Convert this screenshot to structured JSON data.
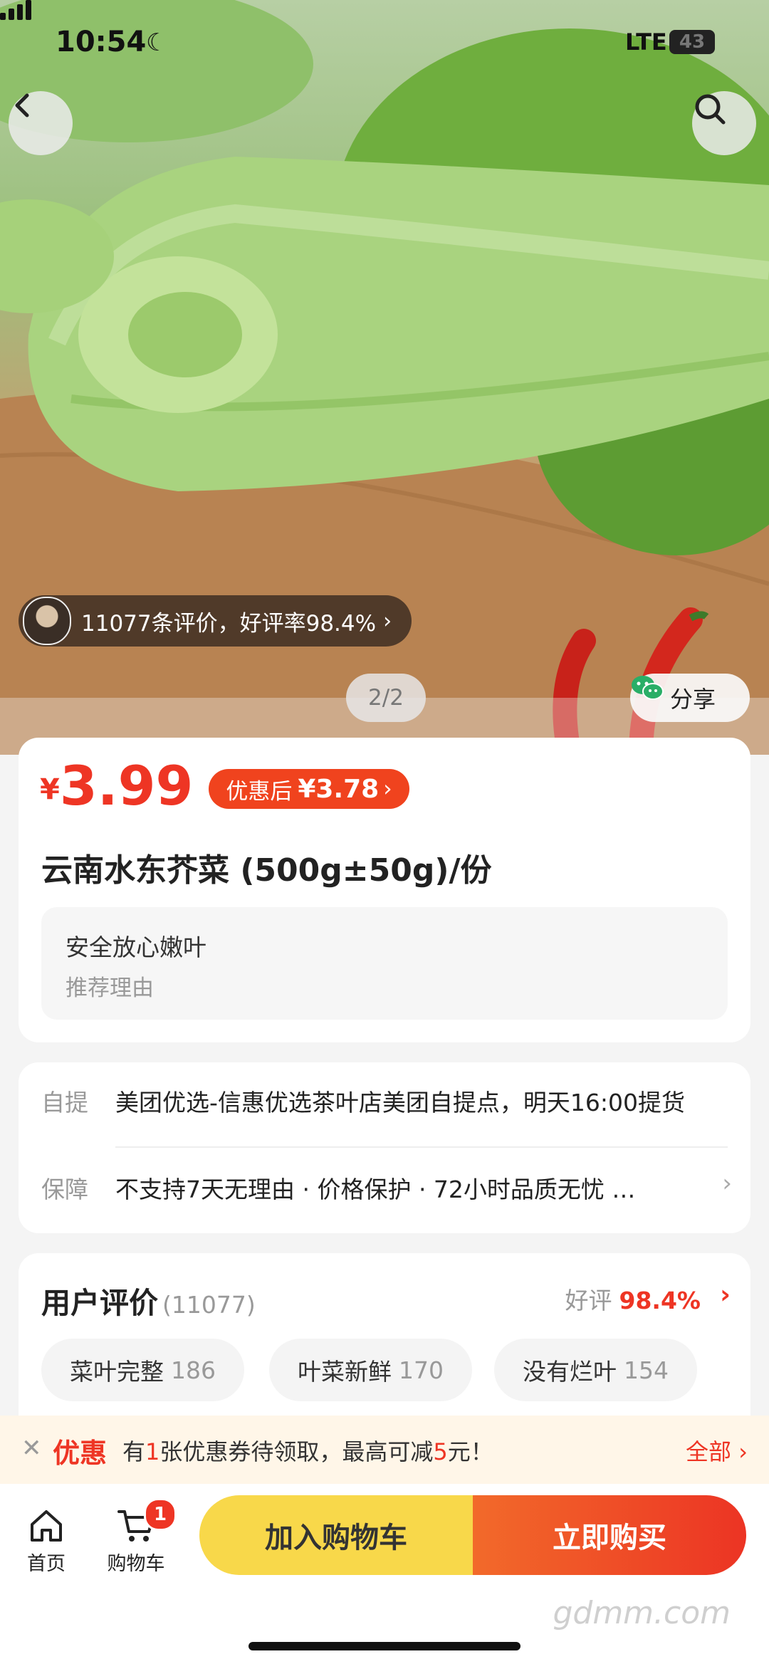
{
  "status_bar": {
    "time": "10:54",
    "network": "LTE",
    "battery": "43"
  },
  "hero": {
    "review_summary": "11077条评价，好评率98.4%",
    "pager": "2/2",
    "share_label": "分享"
  },
  "product": {
    "currency": "¥",
    "price": "3.99",
    "promo_prefix": "优惠后",
    "promo_price": "¥3.78",
    "title": "云南水东芥菜 (500g±50g)/份",
    "reason_title": "安全放心嫩叶",
    "reason_label": "推荐理由"
  },
  "info": {
    "pickup_label": "自提",
    "pickup_text": "美团优选-信惠优选茶叶店美团自提点，明天16:00提货",
    "guarantee_label": "保障",
    "guarantee_text": "不支持7天无理由 · 价格保护 · 72小时品质无忧 …"
  },
  "reviews": {
    "title": "用户评价",
    "count": "(11077)",
    "good_label": "好评",
    "good_rate": "98.4%",
    "tags": [
      {
        "label": "菜叶完整",
        "count": "186"
      },
      {
        "label": "叶菜新鲜",
        "count": "170"
      },
      {
        "label": "没有烂叶",
        "count": "154"
      }
    ]
  },
  "coupon": {
    "tag": "优惠",
    "msg_a": "有",
    "msg_num1": "1",
    "msg_b": "张优惠券待领取，最高可减",
    "msg_num2": "5",
    "msg_c": "元！",
    "all_label": "全部"
  },
  "bottom_bar": {
    "home_label": "首页",
    "cart_label": "购物车",
    "cart_badge": "1",
    "add_to_cart": "加入购物车",
    "buy_now": "立即购买"
  },
  "watermark": "gdmm.com",
  "colors": {
    "accent_red": "#ee3524",
    "cart_yellow": "#f8d84a",
    "promo_orange": "#f0431e"
  }
}
